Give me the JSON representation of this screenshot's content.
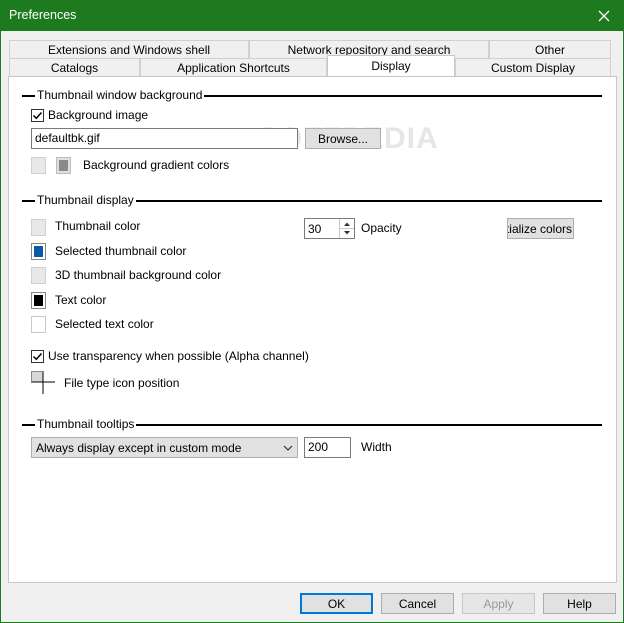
{
  "window": {
    "title": "Preferences"
  },
  "tabs_row1": [
    {
      "label": "Extensions and Windows shell"
    },
    {
      "label": "Network repository and search"
    },
    {
      "label": "Other"
    }
  ],
  "tabs_row2": [
    {
      "label": "Catalogs"
    },
    {
      "label": "Application Shortcuts"
    },
    {
      "label": "Display"
    },
    {
      "label": "Custom Display"
    }
  ],
  "watermark": "SOFTPEDIA",
  "background_section": {
    "title": "Thumbnail window background",
    "background_image_label": "Background image",
    "background_image_checked": true,
    "file_value": "defaultbk.gif",
    "browse_label": "Browse...",
    "gradient_label": "Background gradient colors"
  },
  "display_section": {
    "title": "Thumbnail display",
    "thumbnail_color_label": "Thumbnail color",
    "selected_thumbnail_color_label": "Selected thumbnail color",
    "thumbnail_3d_bg_label": "3D thumbnail background color",
    "text_color_label": "Text color",
    "selected_text_color_label": "Selected text color",
    "opacity_value": "30",
    "opacity_label": "Opacity",
    "reinitialize_label": "Reinitialize colors",
    "transparency_label": "Use transparency when possible (Alpha channel)",
    "transparency_checked": true,
    "file_icon_position_label": "File type icon position"
  },
  "tooltips_section": {
    "title": "Thumbnail tooltips",
    "mode_value": "Always display except in custom mode",
    "width_value": "200",
    "width_label": "Width"
  },
  "footer": {
    "ok_label": "OK",
    "cancel_label": "Cancel",
    "apply_label": "Apply",
    "help_label": "Help"
  },
  "colors": {
    "title_bar": "#1e7a1e",
    "selected_thumbnail": "#0a5aa8",
    "text_color": "#000000",
    "default_button_border": "#0078d7"
  }
}
